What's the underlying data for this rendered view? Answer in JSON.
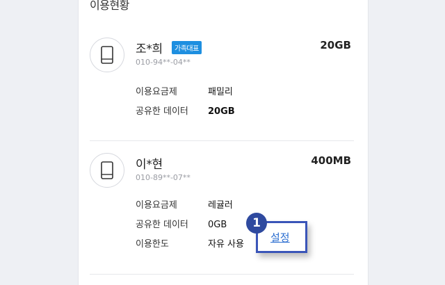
{
  "section": {
    "title": "이용현황"
  },
  "members": [
    {
      "name": "조*희",
      "badge": "가족대표",
      "phone": "010-94**-04**",
      "data_amount": "20GB",
      "rows": [
        {
          "label": "이용요금제",
          "value": "패밀리"
        },
        {
          "label": "공유한 데이터",
          "value": "20GB"
        }
      ]
    },
    {
      "name": "이*현",
      "phone": "010-89**-07**",
      "data_amount": "400MB",
      "rows": [
        {
          "label": "이용요금제",
          "value": "레귤러"
        },
        {
          "label": "공유한 데이터",
          "value": "0GB"
        },
        {
          "label": "이용한도",
          "value": "자유 사용"
        }
      ]
    }
  ],
  "settings_button": {
    "label": "설정"
  },
  "step_marker": {
    "number": "1"
  },
  "icons": {
    "avatar": "mobile-phone-icon"
  },
  "colors": {
    "badge": "#1e8fe0",
    "highlight": "#3a55b8",
    "link": "#2a6dd0"
  }
}
